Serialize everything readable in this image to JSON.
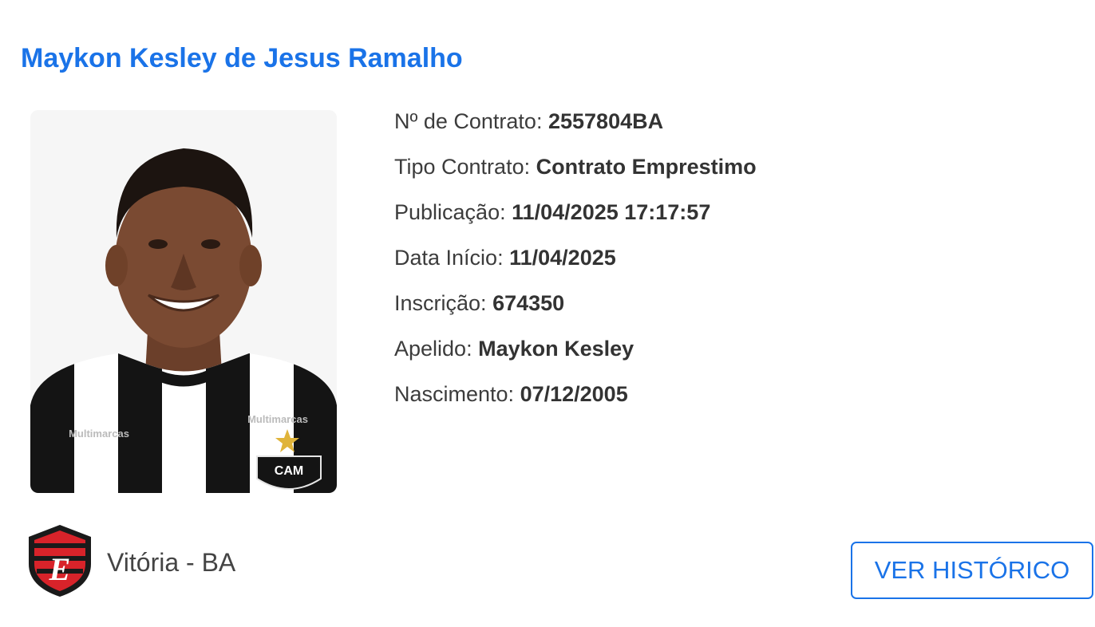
{
  "player": {
    "full_name": "Maykon Kesley de Jesus Ramalho"
  },
  "photo": {
    "sponsor_text": "Multimarcas",
    "crest_text": "CAM"
  },
  "contract": {
    "numero_label": "Nº de Contrato:",
    "numero_value": "2557804BA",
    "tipo_label": "Tipo Contrato:",
    "tipo_value": "Contrato Emprestimo",
    "publicacao_label": "Publicação:",
    "publicacao_value": "11/04/2025 17:17:57",
    "inicio_label": "Data Início:",
    "inicio_value": "11/04/2025",
    "inscricao_label": "Inscrição:",
    "inscricao_value": "674350",
    "apelido_label": "Apelido:",
    "apelido_value": "Maykon Kesley",
    "nascimento_label": "Nascimento:",
    "nascimento_value": "07/12/2005"
  },
  "club": {
    "name": "Vitória - BA",
    "icon": "vitoria-crest-icon",
    "colors": {
      "red": "#d8232a",
      "black": "#1a1a1a"
    }
  },
  "actions": {
    "history_label": "VER HISTÓRICO"
  },
  "colors": {
    "accent": "#1a73e8",
    "text": "#3c3c3c"
  }
}
